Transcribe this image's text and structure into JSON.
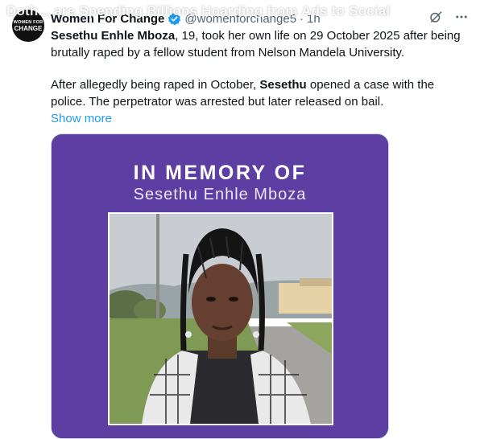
{
  "overlay": {
    "title": "Doth... are Spending Billions Hoarding from Ads to Social"
  },
  "tweet": {
    "author": {
      "name": "Women For Change",
      "handle": "@womenforchange5",
      "separator": "·",
      "time": "1h",
      "avatar_line1": "WOMEN FOR",
      "avatar_line2": "CHANGE",
      "verified_color": "#1d9bf0"
    },
    "body": {
      "p1_bold": "Sesethu Enhle Mboza",
      "p1_rest": ", 19, took her own life on 29 October 2025 after being brutally raped by a fellow student from Nelson Mandela University.",
      "p2_start": "After allegedly being raped in October, ",
      "p2_bold": "Sesethu",
      "p2_rest": " opened a case with the police. The perpetrator was arrested but later released on bail.",
      "show_more": "Show more"
    },
    "media": {
      "title": "IN MEMORY OF",
      "name": "Sesethu Enhle Mboza",
      "background": "#5d3ea3"
    },
    "icons": [
      "grok-icon",
      "more-icon"
    ]
  }
}
